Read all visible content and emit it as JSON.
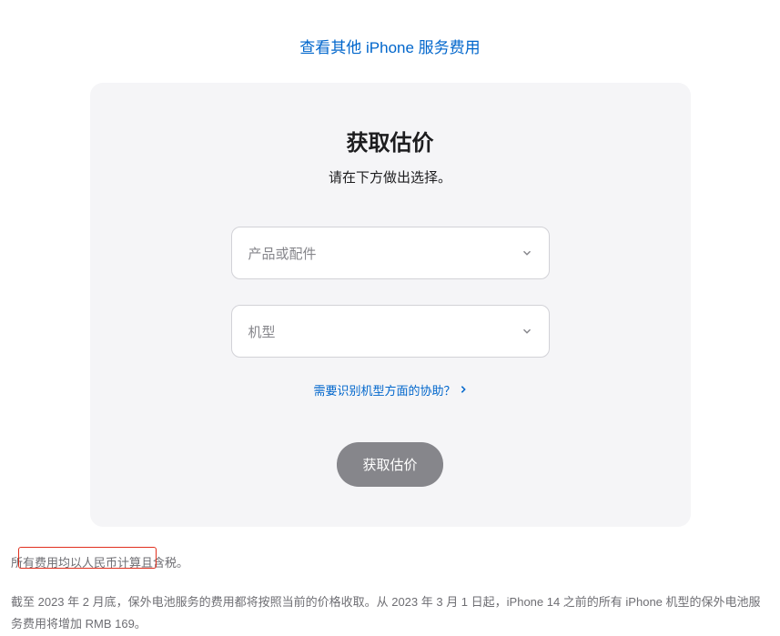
{
  "topLink": {
    "label": "查看其他 iPhone 服务费用"
  },
  "card": {
    "title": "获取估价",
    "subtitle": "请在下方做出选择。",
    "select1": {
      "placeholder": "产品或配件"
    },
    "select2": {
      "placeholder": "机型"
    },
    "helpLink": "需要识别机型方面的协助？",
    "submit": "获取估价"
  },
  "footer": {
    "line1": "所有费用均以人民币计算且含税。",
    "line2": "截至 2023 年 2 月底，保外电池服务的费用都将按照当前的价格收取。从 2023 年 3 月 1 日起，iPhone 14 之前的所有 iPhone 机型的保外电池服务费用将增加 RMB 169。"
  }
}
